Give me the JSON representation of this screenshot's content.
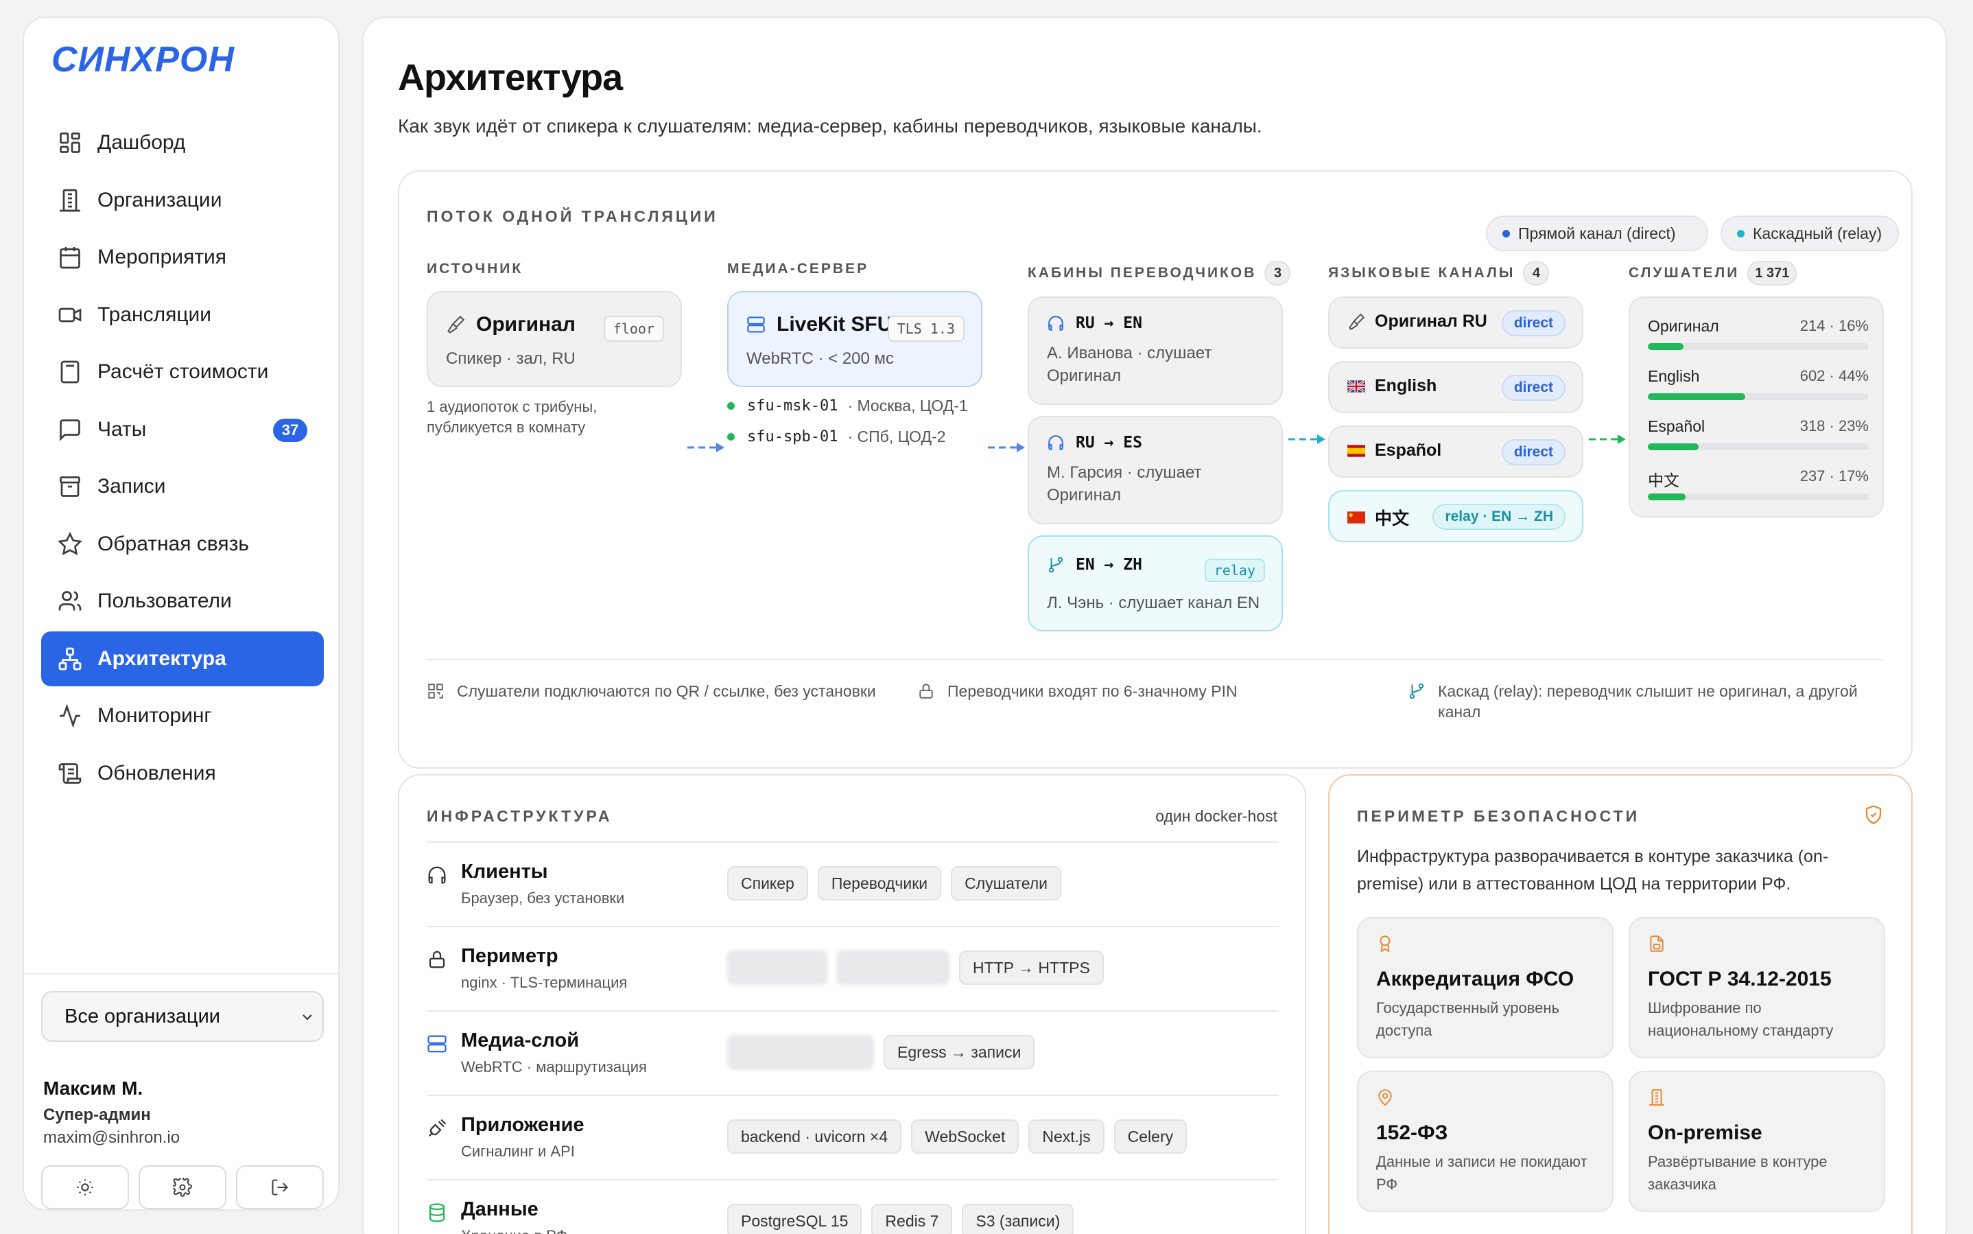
{
  "app": {
    "logo": "СИНХРОН"
  },
  "sidebar": {
    "items": [
      {
        "label": "Дашборд",
        "icon": "dashboard-icon"
      },
      {
        "label": "Организации",
        "icon": "building-icon"
      },
      {
        "label": "Мероприятия",
        "icon": "calendar-icon"
      },
      {
        "label": "Трансляции",
        "icon": "video-icon"
      },
      {
        "label": "Расчёт стоимости",
        "icon": "calculator-icon"
      },
      {
        "label": "Чаты",
        "icon": "chat-icon",
        "badge": "37"
      },
      {
        "label": "Записи",
        "icon": "archive-icon"
      },
      {
        "label": "Обратная связь",
        "icon": "star-icon"
      },
      {
        "label": "Пользователи",
        "icon": "users-icon"
      },
      {
        "label": "Архитектура",
        "icon": "network-icon",
        "active": true
      },
      {
        "label": "Мониторинг",
        "icon": "activity-icon"
      },
      {
        "label": "Обновления",
        "icon": "scroll-icon"
      }
    ],
    "org_select": "Все организации",
    "user": {
      "name": "Максим М.",
      "role": "Супер-админ",
      "email": "maxim@sinhron.io"
    }
  },
  "page": {
    "title": "Архитектура",
    "subtitle": "Как звук идёт от спикера к слушателям: медиа-сервер, кабины переводчиков, языковые каналы."
  },
  "flow": {
    "heading": "ПОТОК ОДНОЙ ТРАНСЛЯЦИИ",
    "legend_direct": "Прямой канал (direct)",
    "legend_relay": "Каскадный (relay)",
    "source": {
      "heading": "ИСТОЧНИК",
      "title": "Оригинал",
      "tag": "floor",
      "sub": "Спикер · зал, RU",
      "note": "1 аудиопоток с трибуны, публикуется в комнату"
    },
    "media": {
      "heading": "МЕДИА-СЕРВЕР",
      "title": "LiveKit SFU",
      "tag": "TLS 1.3",
      "sub": "WebRTC · < 200 мс",
      "servers": [
        {
          "name": "sfu-msk-01",
          "loc": "· Москва, ЦОД-1"
        },
        {
          "name": "sfu-spb-01",
          "loc": "· СПб, ЦОД-2"
        }
      ]
    },
    "booths": {
      "heading": "КАБИНЫ ПЕРЕВОДЧИКОВ",
      "count": "3",
      "items": [
        {
          "title": "RU → EN",
          "sub": "А. Иванова · слушает Оригинал"
        },
        {
          "title": "RU → ES",
          "sub": "М. Гарсия · слушает Оригинал"
        },
        {
          "title": "EN → ZH",
          "tag": "relay",
          "sub": "Л. Чэнь · слушает канал EN"
        }
      ]
    },
    "channels": {
      "heading": "ЯЗЫКОВЫЕ КАНАЛЫ",
      "count": "4",
      "items": [
        {
          "label": "Оригинал RU",
          "pill": "direct"
        },
        {
          "label": "English",
          "pill": "direct"
        },
        {
          "label": "Español",
          "pill": "direct"
        },
        {
          "label": "中文",
          "pill": "relay · EN → ZH"
        }
      ]
    },
    "listeners": {
      "heading": "СЛУШАТЕЛИ",
      "count": "1 371",
      "items": [
        {
          "label": "Оригинал",
          "value": "214 · 16%",
          "share": 16
        },
        {
          "label": "English",
          "value": "602 · 44%",
          "share": 44
        },
        {
          "label": "Español",
          "value": "318 · 23%",
          "share": 23
        },
        {
          "label": "中文",
          "value": "237 · 17%",
          "share": 17
        }
      ]
    },
    "footer": [
      "Слушатели подключаются по QR / ссылке, без установки",
      "Переводчики входят по 6-значному PIN",
      "Каскад (relay): переводчик слышит не оригинал, а другой канал"
    ]
  },
  "infra": {
    "heading": "ИНФРАСТРУКТУРА",
    "note": "один docker-host",
    "rows": [
      {
        "title": "Клиенты",
        "sub": "Браузер, без установки",
        "icon": "headphones-icon",
        "chips": [
          "Спикер",
          "Переводчики",
          "Слушатели"
        ]
      },
      {
        "title": "Периметр",
        "sub": "nginx · TLS-терминация",
        "icon": "lock-icon",
        "chips": [
          "nginx",
          "HTTP → HTTPS"
        ]
      },
      {
        "title": "Медиа-слой",
        "sub": "WebRTC · маршрутизация",
        "icon": "server-icon",
        "chips": [
          "Egress → записи"
        ]
      },
      {
        "title": "Приложение",
        "sub": "Сигналинг и API",
        "icon": "plug-icon",
        "chips": [
          "backend · uvicorn ×4",
          "WebSocket",
          "Next.js",
          "Celery"
        ]
      },
      {
        "title": "Данные",
        "sub": "Хранение в РФ",
        "icon": "database-icon",
        "chips": [
          "PostgreSQL 15",
          "Redis 7",
          "S3 (записи)"
        ]
      }
    ]
  },
  "security": {
    "heading": "ПЕРИМЕТР БЕЗОПАСНОСТИ",
    "text": "Инфраструктура разворачивается в контуре заказчика (on-premise) или в аттестованном ЦОД на территории РФ.",
    "cards": [
      {
        "title": "Аккредитация ФСО",
        "sub": "Государственный уровень доступа"
      },
      {
        "title": "ГОСТ Р 34.12-2015",
        "sub": "Шифрование по национальному стандарту"
      },
      {
        "title": "152-ФЗ",
        "sub": "Данные и записи не покидают РФ"
      },
      {
        "title": "On-premise",
        "sub": "Развёртывание в контуре заказчика"
      }
    ]
  },
  "colors": {
    "accent": "#2a65e6",
    "direct": "#2a62d6",
    "relay": "#1a8fa0",
    "green": "#22b85a",
    "security": "#e8872c"
  }
}
